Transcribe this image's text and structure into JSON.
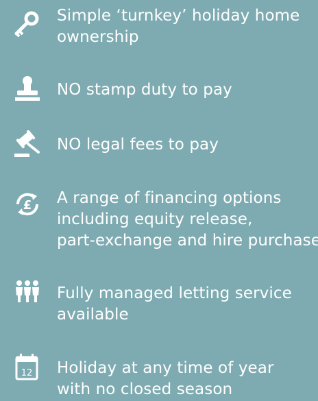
{
  "features": [
    {
      "icon": "key-icon",
      "line1": "Simple ‘turnkey’ holiday home",
      "line2": "ownership"
    },
    {
      "icon": "stamp-icon",
      "line1": "NO stamp duty to pay",
      "line2": ""
    },
    {
      "icon": "gavel-icon",
      "line1": "NO legal fees to pay",
      "line2": ""
    },
    {
      "icon": "pound-cycle-icon",
      "line1": "A range of financing options",
      "line2": "including equity release,",
      "line3": "part-exchange and hire purchase"
    },
    {
      "icon": "people-icon",
      "line1": "Fully managed letting service",
      "line2": "available"
    },
    {
      "icon": "calendar-icon",
      "line1": "Holiday at any time of year",
      "line2": "with no closed season",
      "calendar_day": "12"
    }
  ]
}
